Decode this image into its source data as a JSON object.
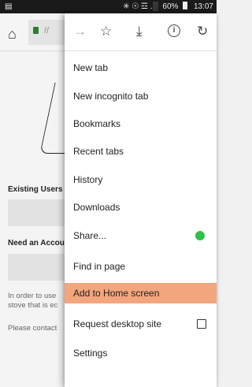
{
  "status_bar": {
    "left_icon": "image-icon",
    "signal_text": "✳ ☉ ☲ .░",
    "battery": "60%",
    "time": "13:07"
  },
  "toolbar": {
    "home_icon": "home-icon",
    "url_partial": "//"
  },
  "menu": {
    "top_icons": [
      "forward-icon",
      "bookmark-star-icon",
      "download-icon",
      "info-icon",
      "reload-icon"
    ],
    "items": [
      {
        "label": "New tab"
      },
      {
        "label": "New incognito tab"
      },
      {
        "label": "Bookmarks"
      },
      {
        "label": "Recent tabs"
      },
      {
        "label": "History"
      },
      {
        "label": "Downloads"
      },
      {
        "label": "Share..."
      },
      {
        "label": "Find in page"
      },
      {
        "label": "Add to Home screen",
        "highlighted": true
      },
      {
        "label": "Request desktop site"
      },
      {
        "label": "Settings"
      }
    ],
    "highlight_color": "#f3a57d",
    "share_badge_color": "#2ec04a"
  },
  "background_page": {
    "existing_users": "Existing Users",
    "need_account": "Need an Accou",
    "para_line1": "In order to use",
    "para_line2": "stove that is ec",
    "contact": "Please contact"
  }
}
